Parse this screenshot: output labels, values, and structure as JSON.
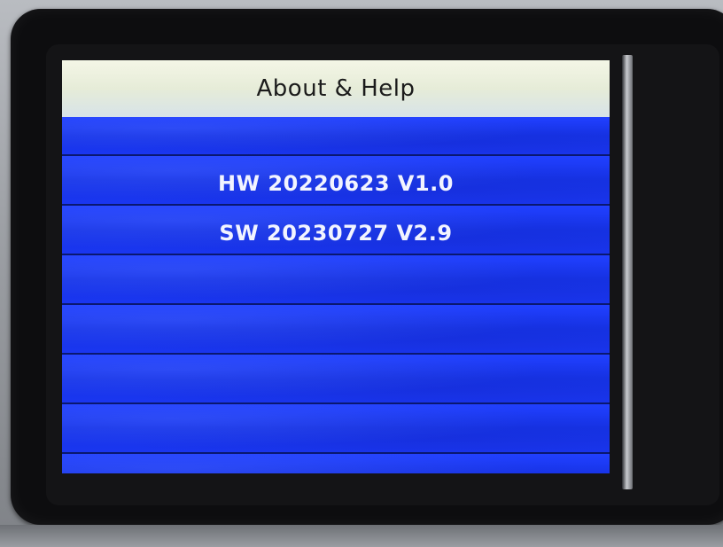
{
  "screen": {
    "title": "About & Help",
    "rows": [
      {
        "text": ""
      },
      {
        "text": "HW 20220623 V1.0"
      },
      {
        "text": "SW 20230727 V2.9"
      },
      {
        "text": ""
      },
      {
        "text": ""
      },
      {
        "text": ""
      },
      {
        "text": ""
      },
      {
        "text": ""
      }
    ]
  },
  "colors": {
    "screen_background": "#1a2fe8",
    "header_background": "#e6ecd8",
    "row_divider": "#0a1870",
    "text_primary": "#f2f4ff",
    "header_text": "#1b1b1b"
  }
}
